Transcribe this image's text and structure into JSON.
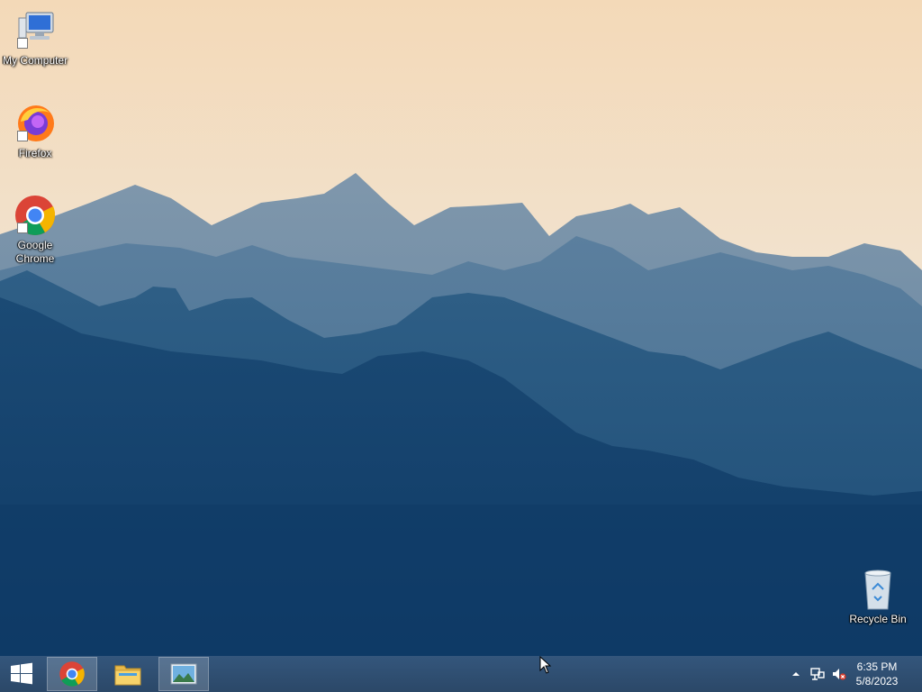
{
  "desktop": {
    "icons": [
      {
        "label": "My Computer",
        "icon": "computer-icon"
      },
      {
        "label": "Firefox",
        "icon": "firefox-icon"
      },
      {
        "label": "Google Chrome",
        "icon": "chrome-icon"
      },
      {
        "label": "Recycle Bin",
        "icon": "recycle-bin-icon"
      }
    ]
  },
  "taskbar": {
    "start_icon": "windows-logo-icon",
    "pinned": [
      {
        "app": "Google Chrome",
        "icon": "chrome-icon",
        "active": true
      },
      {
        "app": "File Explorer",
        "icon": "folder-icon",
        "active": false
      },
      {
        "app": "Photos",
        "icon": "photo-viewer-icon",
        "active": true
      }
    ],
    "tray": {
      "icons": [
        "show-hidden-icons-icon",
        "network-icon",
        "volume-muted-icon"
      ],
      "time": "6:35 PM",
      "date": "5/8/2023"
    }
  },
  "colors": {
    "taskbar": "#2d4a6c",
    "sky_top": "#f2dcc0",
    "mountain_deep": "#123e6a"
  }
}
